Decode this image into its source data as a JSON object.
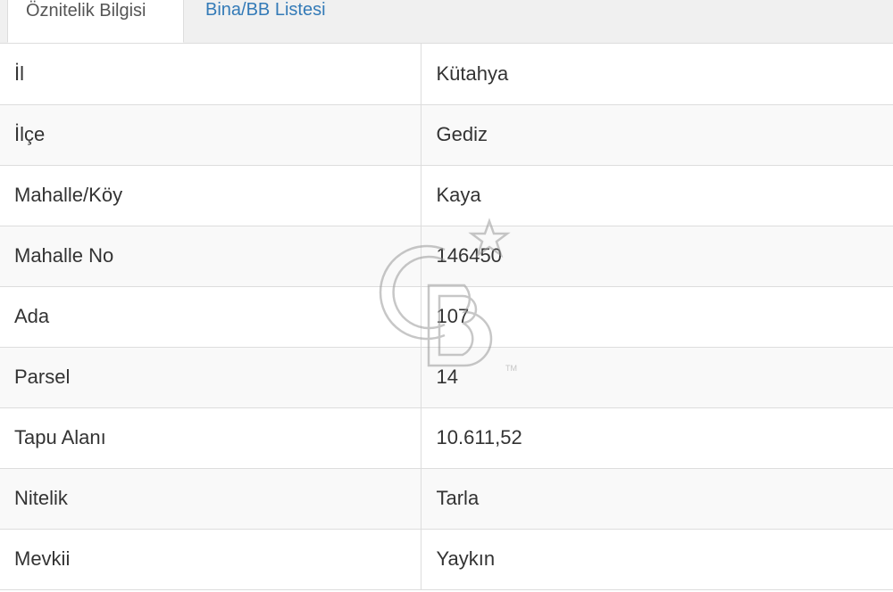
{
  "tabs": [
    {
      "label": "Öznitelik Bilgisi",
      "active": true
    },
    {
      "label": "Bina/BB Listesi",
      "active": false
    }
  ],
  "rows": [
    {
      "label": "İl",
      "value": "Kütahya"
    },
    {
      "label": "İlçe",
      "value": "Gediz"
    },
    {
      "label": "Mahalle/Köy",
      "value": "Kaya"
    },
    {
      "label": "Mahalle No",
      "value": "146450"
    },
    {
      "label": "Ada",
      "value": "107"
    },
    {
      "label": "Parsel",
      "value": "14"
    },
    {
      "label": "Tapu Alanı",
      "value": "10.611,52"
    },
    {
      "label": "Nitelik",
      "value": "Tarla"
    },
    {
      "label": "Mevkii",
      "value": "Yaykın"
    }
  ],
  "watermark": {
    "text": "CB",
    "tm": "TM",
    "icon": "star-icon"
  },
  "colors": {
    "link": "#337ab7",
    "border": "#dddddd",
    "stripe": "#f9f9f9",
    "text": "#333333"
  }
}
